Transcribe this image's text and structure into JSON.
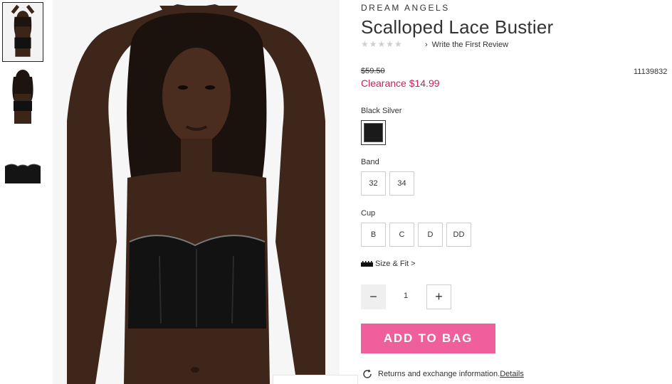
{
  "thumbnails": [
    {
      "icon": "model-front-thumbnail"
    },
    {
      "icon": "model-back-thumbnail"
    },
    {
      "icon": "product-flat-thumbnail"
    }
  ],
  "product": {
    "brand": "DREAM ANGELS",
    "title": "Scalloped Lace Bustier",
    "stars": "★★★★★",
    "review_link": "Write the First Review",
    "original_price": "$59.50",
    "sale_price": "Clearance $14.99",
    "sku": "11139832"
  },
  "color": {
    "label": "Black Silver",
    "swatch_color": "#1a1a1a"
  },
  "band": {
    "label": "Band",
    "options": [
      "32",
      "34"
    ]
  },
  "cup": {
    "label": "Cup",
    "options": [
      "B",
      "C",
      "D",
      "DD"
    ]
  },
  "size_fit": {
    "label": "Size & Fit",
    "chevron": ">"
  },
  "quantity": {
    "minus": "−",
    "value": "1",
    "plus": "+"
  },
  "cart": {
    "add_label": "ADD TO BAG"
  },
  "returns": {
    "text": "Returns and exchange information.",
    "link": "Details"
  },
  "colors": {
    "accent_pink": "#ef5f9c",
    "clearance_red": "#d21c5d"
  }
}
